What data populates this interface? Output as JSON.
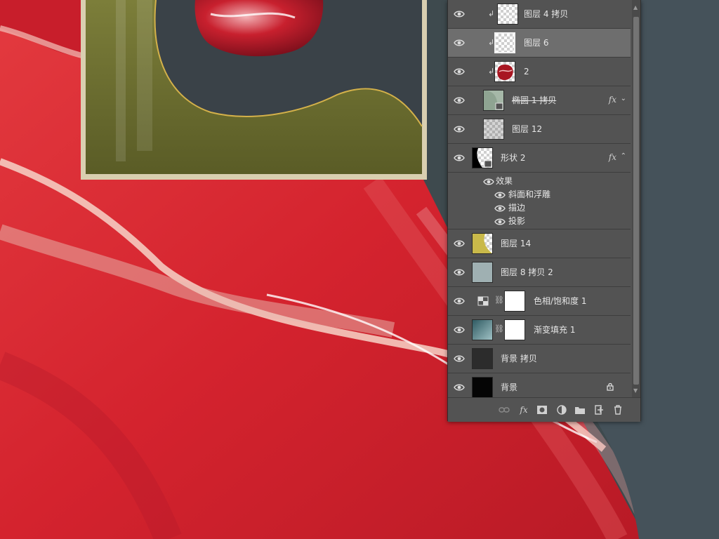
{
  "layers_panel": {
    "layers": [
      {
        "name": "图层 4 拷贝",
        "clipped": true,
        "thumb": "checker-white",
        "selected": false
      },
      {
        "name": "图层 6",
        "clipped": true,
        "thumb": "checker-outlined",
        "selected": true
      },
      {
        "name": "2",
        "clipped": true,
        "thumb": "red-agate",
        "selected": false
      },
      {
        "name": "椭圆 1 拷贝",
        "clipped": false,
        "thumb": "shape-green",
        "selected": false,
        "fx": "fx",
        "expanded": false
      },
      {
        "name": "图层 12",
        "clipped": false,
        "thumb": "checker-gray",
        "selected": false
      },
      {
        "name": "形状 2",
        "clipped": false,
        "thumb": "shape-black",
        "selected": false,
        "fx": "fx",
        "expanded": true
      }
    ],
    "effects": {
      "header": "效果",
      "items": [
        "斜面和浮雕",
        "描边",
        "投影"
      ]
    },
    "layers_after": [
      {
        "name": "图层 14",
        "thumb": "checker-yellow"
      },
      {
        "name": "图层 8 拷贝 2",
        "thumb": "texture-gray"
      },
      {
        "name": "色相/饱和度 1",
        "thumb": "adjustment-hue",
        "mask": true
      },
      {
        "name": "渐变填充 1",
        "thumb": "gradient-fill",
        "mask": true
      },
      {
        "name": "背景 拷贝",
        "thumb": "dark-gray"
      },
      {
        "name": "背景",
        "thumb": "black",
        "locked": true
      }
    ],
    "footer_buttons": [
      "link-icon",
      "fx-icon",
      "mask-icon",
      "adjustment-icon",
      "folder-icon",
      "new-layer-icon",
      "trash-icon"
    ],
    "fx_label": "fx"
  },
  "colors": {
    "panel_bg": "#535353",
    "selected_row": "#6e6e6e",
    "agate_red": "#d4232e",
    "frame_green": "#6b6d2e",
    "frame_dark": "#3a4248",
    "gold_line": "#c8a83a",
    "backdrop": "#3e4a4e"
  }
}
